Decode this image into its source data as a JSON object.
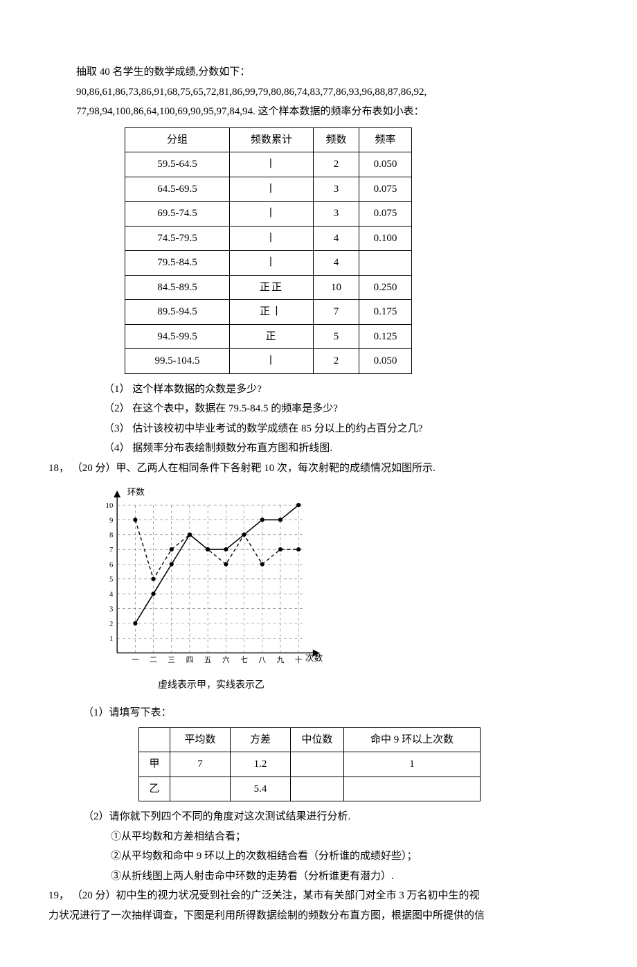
{
  "intro": {
    "line1": "抽取 40 名学生的数学成绩,分数如下：",
    "line2": "90,86,61,86,73,86,91,68,75,65,72,81,86,99,79,80,86,74,83,77,86,93,96,88,87,86,92,",
    "line3": "77,98,94,100,86,64,100,69,90,95,97,84,94. 这个样本数据的频率分布表如小表：",
    "header": {
      "group": "分组",
      "tally": "频数累计",
      "freq": "频数",
      "rate": "频率"
    },
    "rows": [
      {
        "group": "59.5-64.5",
        "tally": "丨",
        "freq": "2",
        "rate": "0.050"
      },
      {
        "group": "64.5-69.5",
        "tally": "丨",
        "freq": "3",
        "rate": "0.075"
      },
      {
        "group": "69.5-74.5",
        "tally": "丨",
        "freq": "3",
        "rate": "0.075"
      },
      {
        "group": "74.5-79.5",
        "tally": "丨",
        "freq": "4",
        "rate": "0.100"
      },
      {
        "group": "79.5-84.5",
        "tally": "丨",
        "freq": "4",
        "rate": ""
      },
      {
        "group": "84.5-89.5",
        "tally": "正正",
        "freq": "10",
        "rate": "0.250"
      },
      {
        "group": "89.5-94.5",
        "tally": "正丨",
        "freq": "7",
        "rate": "0.175"
      },
      {
        "group": "94.5-99.5",
        "tally": "正",
        "freq": "5",
        "rate": "0.125"
      },
      {
        "group": "99.5-104.5",
        "tally": "丨",
        "freq": "2",
        "rate": "0.050"
      }
    ],
    "q1": "（1）  这个样本数据的众数是多少?",
    "q2": "（2）  在这个表中，数据在 79.5-84.5 的频率是多少?",
    "q3": "（3）  估计该校初中毕业考试的数学成绩在 85 分以上的约占百分之几?",
    "q4": "（4）  据频率分布表绘制频数分布直方图和折线图."
  },
  "q18": {
    "head": "18，  （20 分）甲、乙两人在相同条件下各射靶 10 次，每次射靶的成绩情况如图所示.",
    "chart_caption": "虚线表示甲，实线表示乙",
    "chart_labels": {
      "y": "环数",
      "x": "次数"
    },
    "chart_ticks_y": [
      "1",
      "2",
      "3",
      "4",
      "5",
      "6",
      "7",
      "8",
      "9",
      "10"
    ],
    "chart_ticks_x": [
      "一",
      "二",
      "三",
      "四",
      "五",
      "六",
      "七",
      "八",
      "九",
      "十"
    ],
    "sub1": "（1）请填写下表：",
    "stat_header": {
      "name": "",
      "avg": "平均数",
      "var": "方差",
      "med": "中位数",
      "hit": "命中 9 环以上次数"
    },
    "stat_rows": [
      {
        "name": "甲",
        "avg": "7",
        "var": "1.2",
        "med": "",
        "hit": "1"
      },
      {
        "name": "乙",
        "avg": "",
        "var": "5.4",
        "med": "",
        "hit": ""
      }
    ],
    "sub2": "（2）请你就下列四个不同的角度对这次测试结果进行分析.",
    "sub2a": "①从平均数和方差相结合看；",
    "sub2b": "②从平均数和命中 9 环以上的次数相结合看（分析谁的成绩好些）；",
    "sub2c": "③从折线图上两人射击命中环数的走势看（分析谁更有潜力）."
  },
  "q19": {
    "line1": "19，  （20 分）初中生的视力状况受到社会的广泛关注，某市有关部门对全市 3 万名初中生的视",
    "line2": "力状况进行了一次抽样调查，下图是利用所得数据绘制的频数分布直方图，根据图中所提供的信"
  },
  "chart_data": {
    "type": "line",
    "title": "",
    "xlabel": "次数",
    "ylabel": "环数",
    "x": [
      1,
      2,
      3,
      4,
      5,
      6,
      7,
      8,
      9,
      10
    ],
    "ylim": [
      0,
      10
    ],
    "series": [
      {
        "name": "甲（虚线）",
        "values": [
          9,
          5,
          7,
          8,
          7,
          6,
          8,
          6,
          7,
          7
        ]
      },
      {
        "name": "乙（实线）",
        "values": [
          2,
          4,
          6,
          8,
          7,
          7,
          8,
          9,
          9,
          10
        ]
      }
    ]
  }
}
